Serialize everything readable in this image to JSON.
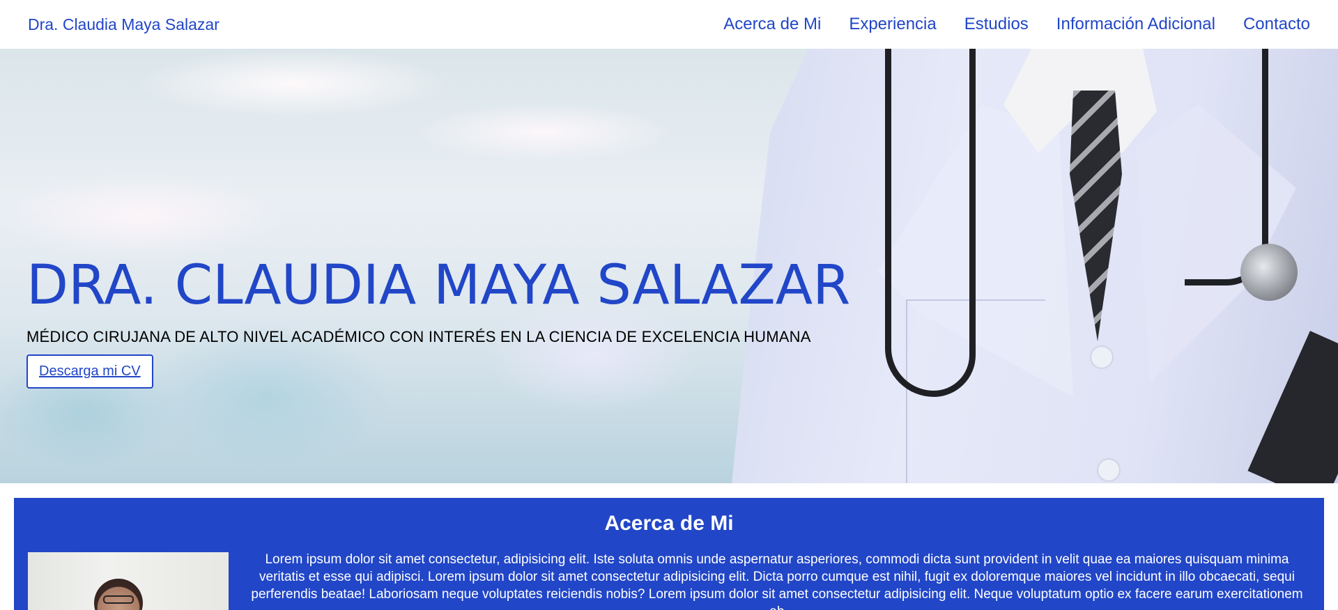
{
  "navbar": {
    "brand": "Dra. Claudia Maya Salazar",
    "links": [
      "Acerca de Mi",
      "Experiencia",
      "Estudios",
      "Información Adicional",
      "Contacto"
    ]
  },
  "hero": {
    "title": "DRA. CLAUDIA MAYA SALAZAR",
    "subtitle": "MÉDICO CIRUJANA DE ALTO NIVEL ACADÉMICO CON INTERÉS EN LA CIENCIA DE EXCELENCIA HUMANA",
    "cv_button": "Descarga mi CV"
  },
  "about": {
    "title": "Acerca de Mi",
    "text": "Lorem ipsum dolor sit amet consectetur, adipisicing elit. Iste soluta omnis unde aspernatur asperiores, commodi dicta sunt provident in velit quae ea maiores quisquam minima veritatis et esse qui adipisci. Lorem ipsum dolor sit amet consectetur adipisicing elit. Dicta porro cumque est nihil, fugit ex doloremque maiores vel incidunt in illo obcaecati, sequi perferendis beatae! Laboriosam neque voluptates reiciendis nobis? Lorem ipsum dolor sit amet consectetur adipisicing elit. Neque voluptatum optio ex facere earum exercitationem ab"
  },
  "colors": {
    "accent": "#2146c7",
    "about_background": "#2146c7",
    "nav_background": "#ffffff"
  }
}
